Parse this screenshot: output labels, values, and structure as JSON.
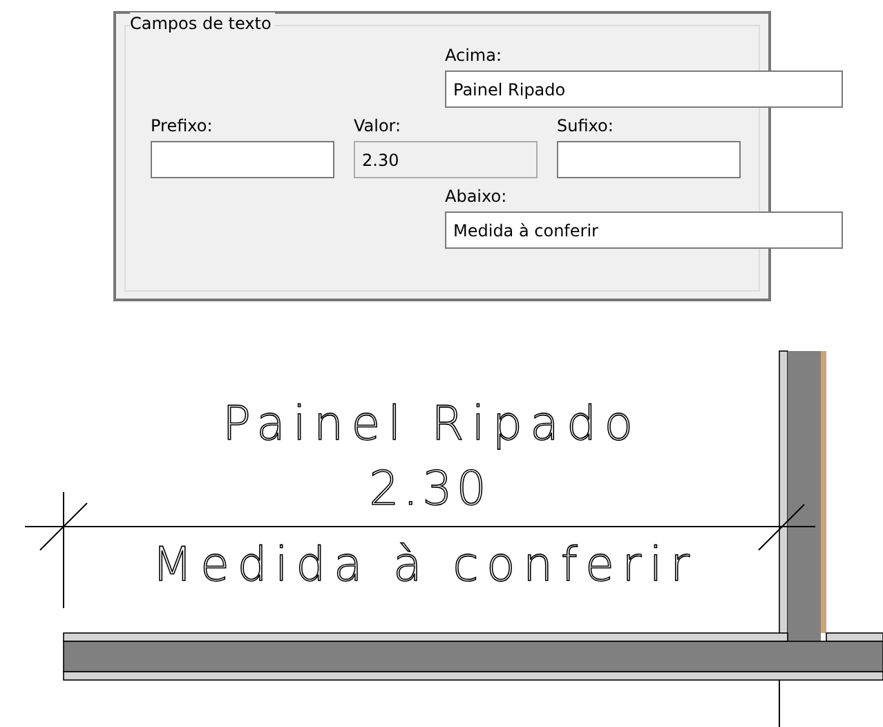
{
  "group": {
    "title": "Campos de texto",
    "fields": [
      {
        "kind": "above",
        "label": "Acima:",
        "value": "Painel Ripado",
        "disabled": false
      },
      {
        "kind": "prefix",
        "label": "Prefixo:",
        "disabled": false
      },
      {
        "kind": "value",
        "label": "Valor:",
        "value": "2.30",
        "disabled": true
      },
      {
        "kind": "suffix",
        "label": "Sufixo:",
        "disabled": false
      },
      {
        "kind": "below",
        "label": "Abaixo:",
        "value": "Medida à conferir",
        "disabled": false
      }
    ]
  },
  "drawing": {
    "above_text": "Painel Ripado",
    "value_text": "2.30",
    "below_text": "Medida à conferir"
  }
}
